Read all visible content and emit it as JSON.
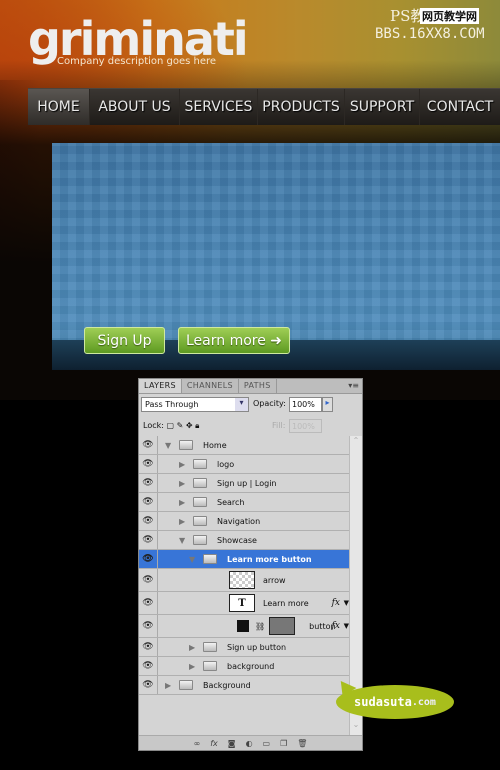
{
  "site": {
    "logo": "griminati",
    "tagline": "Company description goes here",
    "watermark": [
      "PS教程论坛",
      "网页教学网",
      "BBS.16XX8.COM"
    ],
    "nav": [
      "HOME",
      "ABOUT US",
      "SERVICES",
      "PRODUCTS",
      "SUPPORT",
      "CONTACT"
    ],
    "active_nav": "HOME",
    "buttons": {
      "signup": "Sign Up",
      "learn": "Learn more",
      "learn_icon": "arrow-right-icon"
    }
  },
  "panel": {
    "tabs": [
      "LAYERS",
      "CHANNELS",
      "PATHS"
    ],
    "blend_mode": "Pass Through",
    "opacity_label": "Opacity:",
    "opacity": "100%",
    "lock_label": "Lock:",
    "fill_label": "Fill:",
    "fill": "100%",
    "layers": [
      {
        "name": "Home",
        "type": "group",
        "expanded": true,
        "level": 0
      },
      {
        "name": "logo",
        "type": "group",
        "level": 1
      },
      {
        "name": "Sign up  |  Login",
        "type": "group",
        "level": 1
      },
      {
        "name": "Search",
        "type": "group",
        "level": 1
      },
      {
        "name": "Navigation",
        "type": "group",
        "level": 1
      },
      {
        "name": "Showcase",
        "type": "group",
        "expanded": true,
        "level": 1
      },
      {
        "name": "Learn more button",
        "type": "group",
        "expanded": true,
        "level": 2,
        "selected": true
      },
      {
        "name": "arrow",
        "type": "smart",
        "level": 3
      },
      {
        "name": "Learn more",
        "type": "text",
        "level": 3,
        "fx": "fx",
        "thumb": "T"
      },
      {
        "name": "button",
        "type": "shape",
        "level": 3,
        "fx": "fx"
      },
      {
        "name": "Sign up  button",
        "type": "group",
        "level": 2
      },
      {
        "name": "background",
        "type": "group",
        "level": 2
      },
      {
        "name": "Background",
        "type": "group",
        "level": 0
      }
    ]
  },
  "badge": {
    "text": "sudasuta",
    ".com": ".com",
    "suffix": ".com"
  },
  "colors": {
    "selected": "#3875d7",
    "button_green": "#7fb83a",
    "bubble": "#a8be1c"
  }
}
